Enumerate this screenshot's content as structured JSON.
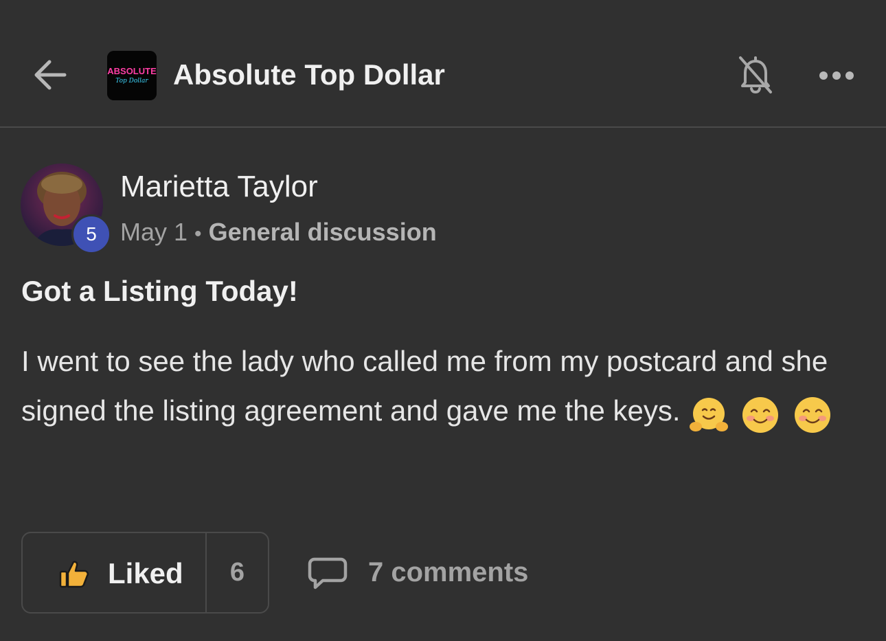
{
  "header": {
    "group_name": "Absolute Top Dollar",
    "logo_text_line1": "ABSOLUTE",
    "logo_text_line2": "Top Dollar",
    "back_icon": "arrow-left-icon",
    "bell_icon": "bell-muted-icon",
    "more_icon": "more-horizontal-icon"
  },
  "post": {
    "author": {
      "name": "Marietta Taylor",
      "level": "5"
    },
    "date": "May 1",
    "separator": "•",
    "topic": "General discussion",
    "title": "Got a Listing Today!",
    "body": "I went to see the lady who called me from my postcard and she signed the listing agreement and gave me the keys.",
    "emojis": [
      "hugging-face-emoji",
      "smiling-face-emoji",
      "smiling-face-emoji"
    ]
  },
  "actions": {
    "like_label": "Liked",
    "like_count": "6",
    "comments_label": "7 comments"
  },
  "colors": {
    "background": "#303030",
    "divider": "#4a4a4a",
    "text_primary": "#f0f0f0",
    "text_secondary": "#a3a3a3",
    "level_badge": "#3f51b5",
    "logo_pink": "#ff3ea5",
    "logo_cyan": "#3fd8ff"
  }
}
